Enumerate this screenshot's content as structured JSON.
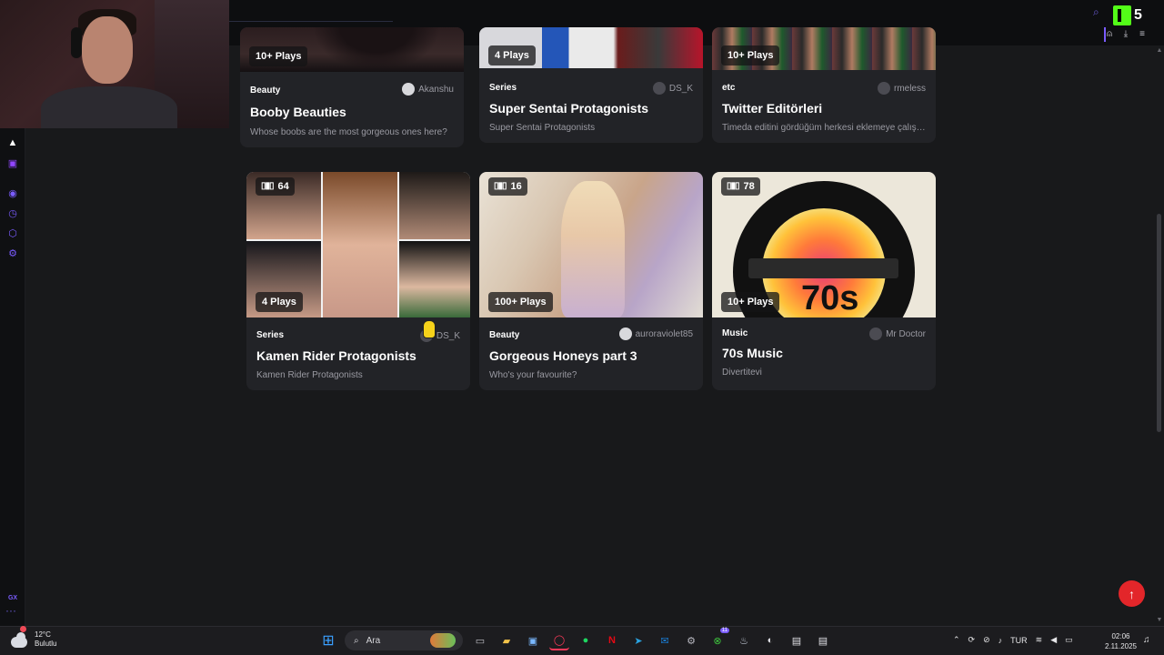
{
  "stream": {
    "viewer_count": "5"
  },
  "cards_row1": [
    {
      "plays": "10+ Plays",
      "category": "Beauty",
      "author": "Akanshu",
      "title": "Booby Beauties",
      "description": "Whose boobs are the most gorgeous ones here?"
    },
    {
      "plays": "4 Plays",
      "category": "Series",
      "author": "DS_K",
      "title": "Super Sentai Protagonists",
      "description": "Super Sentai Protagonists"
    },
    {
      "plays": "10+ Plays",
      "category": "etc",
      "author": "rmeless",
      "title": "Twitter Editörleri",
      "description": "Timeda editini gördüğüm herkesi eklemeye çalıştım..."
    }
  ],
  "cards_row2": [
    {
      "count": "64",
      "plays": "4 Plays",
      "category": "Series",
      "author": "DS_K",
      "title": "Kamen Rider Protagonists",
      "description": "Kamen Rider Protagonists"
    },
    {
      "count": "16",
      "plays": "100+ Plays",
      "category": "Beauty",
      "author": "auroraviolet85",
      "title": "Gorgeous Honeys part 3",
      "description": "Who's your favourite?"
    },
    {
      "count": "78",
      "plays": "10+ Plays",
      "category": "Music",
      "author": "Mr Doctor",
      "title": "70s Music",
      "description": "Divertitevi"
    }
  ],
  "rail": {
    "gx_label": "GX",
    "more": "···"
  },
  "taskbar": {
    "temperature": "12°C",
    "weather": "Bulutlu",
    "search_label": "Ara",
    "language": "TUR",
    "time": "02:06",
    "date": "2.11.2025",
    "xbox_badge": "11"
  },
  "icons": {
    "to_top": "arrow-up-icon",
    "search": "search-icon",
    "windows": "windows-start-icon"
  },
  "colors": {
    "accent": "#7a5cff",
    "kick_green": "#53fc18",
    "to_top_red": "#e3262a",
    "card_bg": "#222327"
  }
}
